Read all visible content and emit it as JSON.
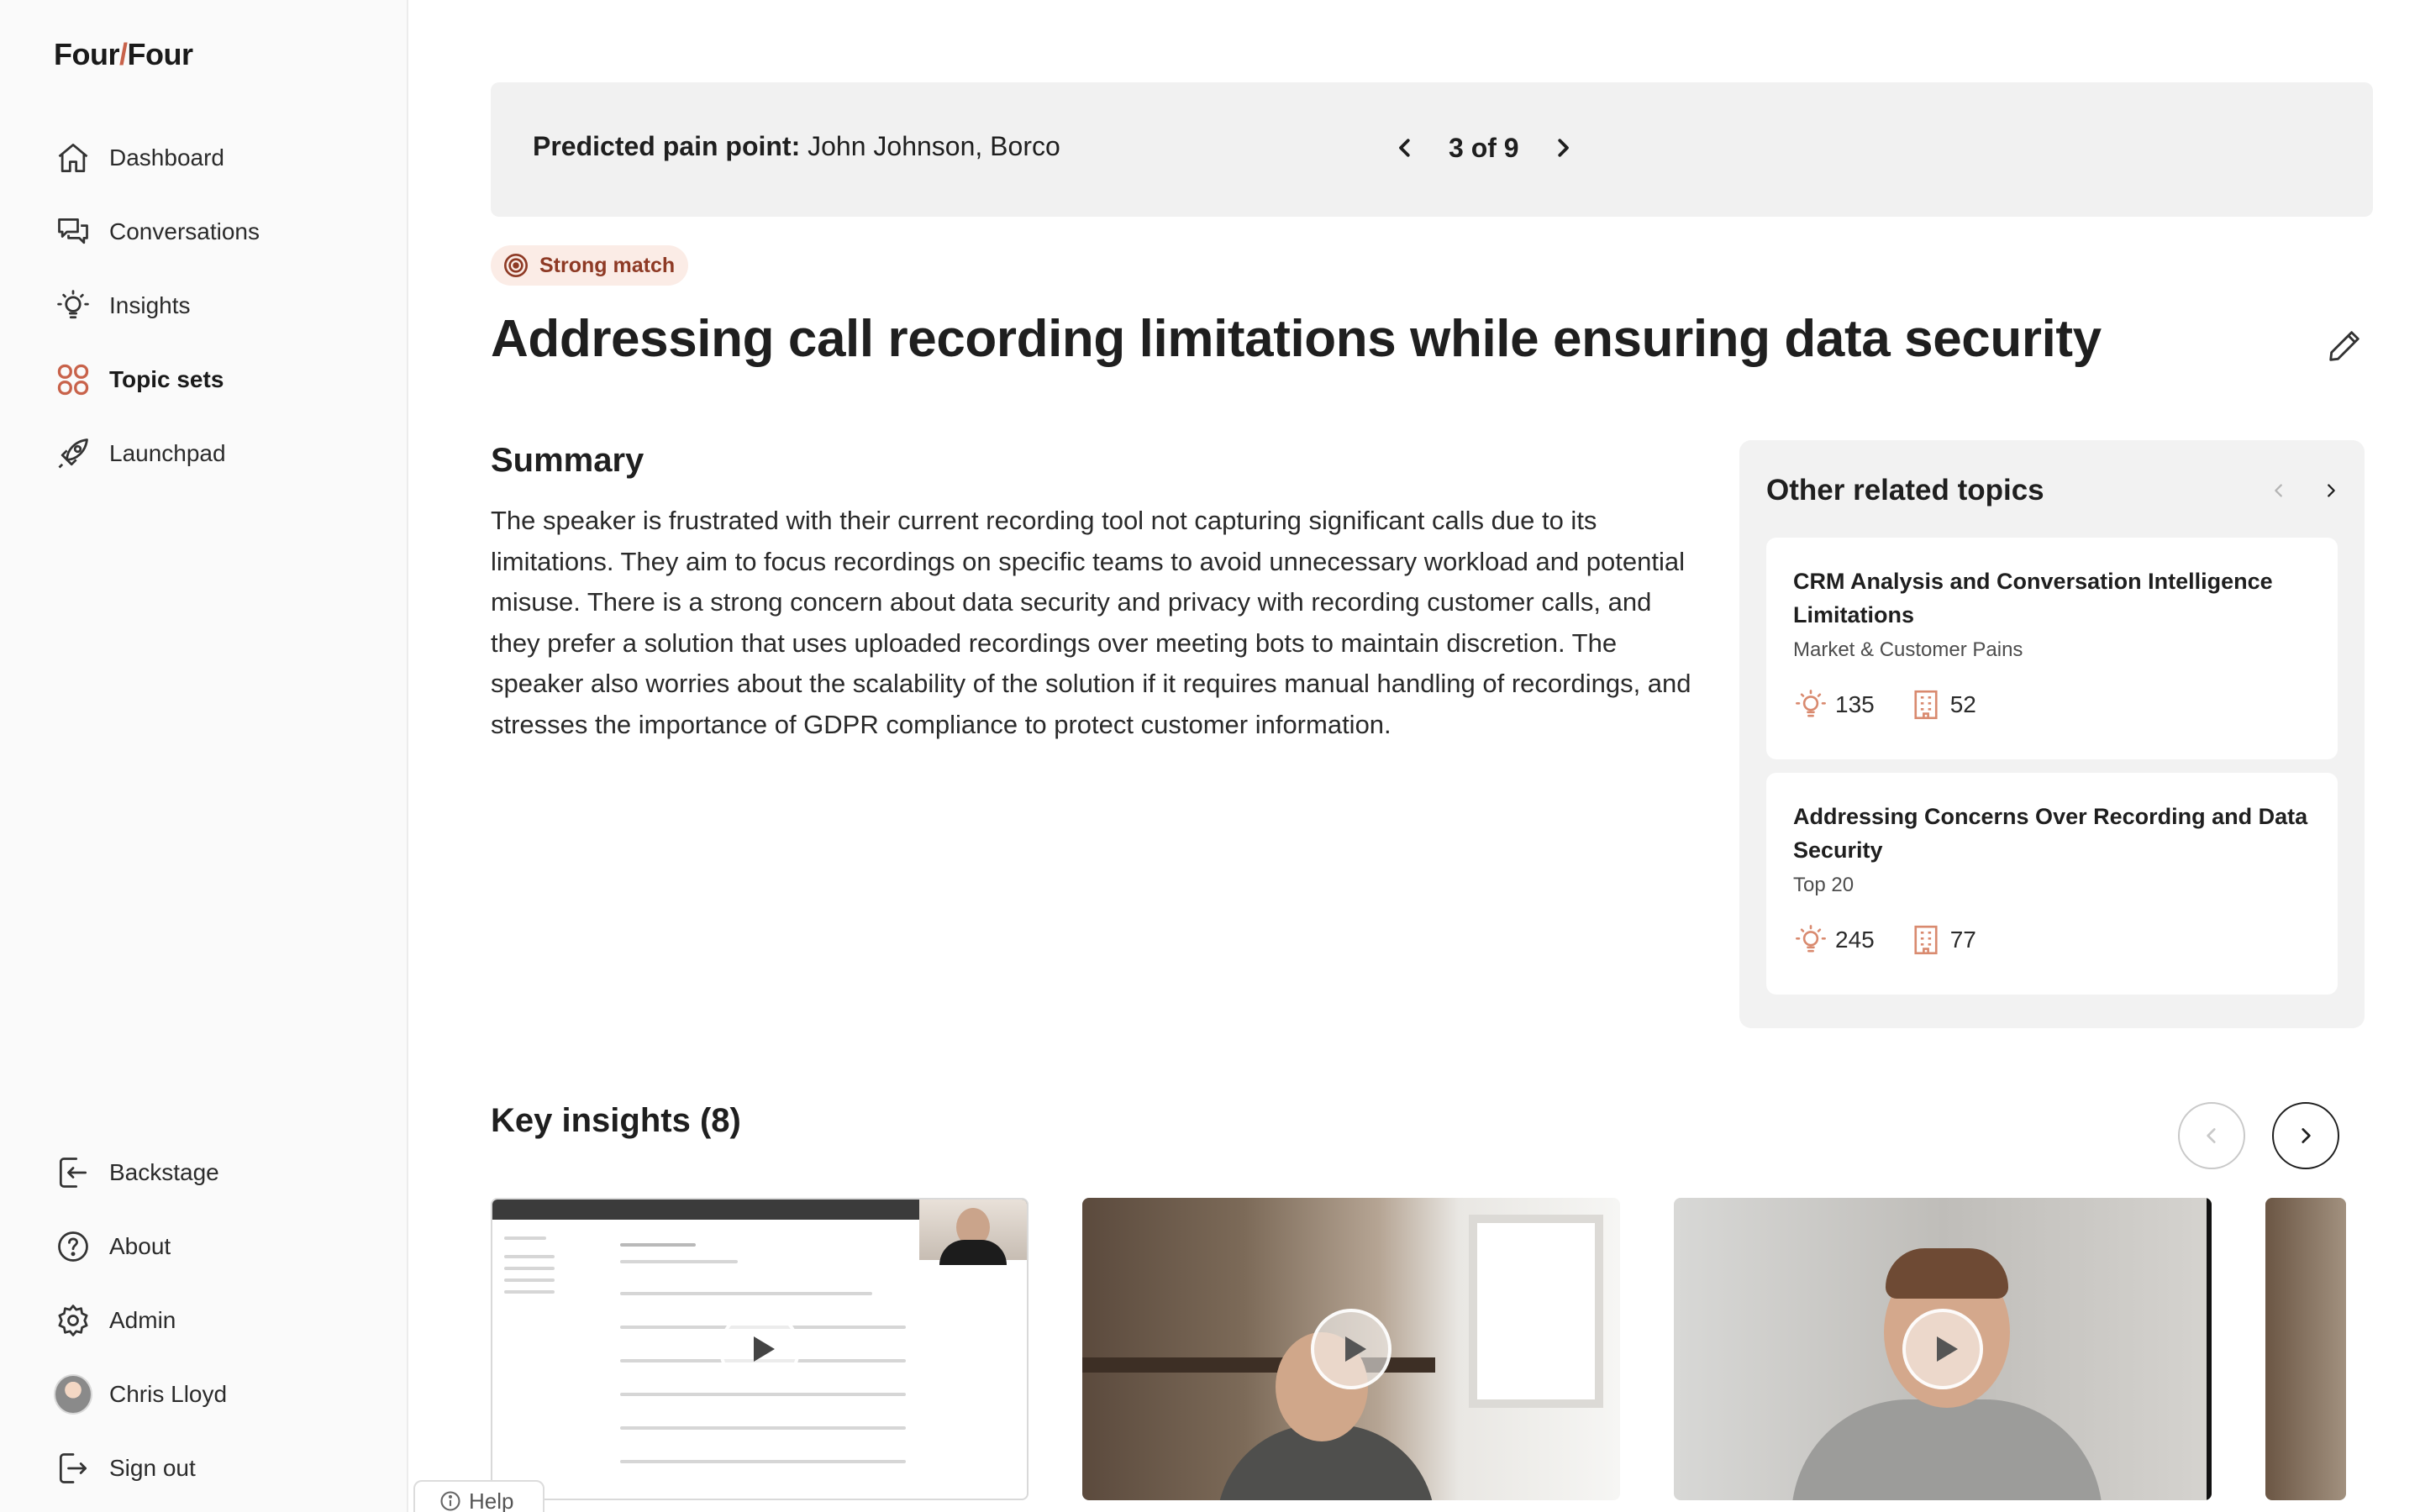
{
  "app": {
    "logo_left": "Four",
    "logo_slash": "/",
    "logo_right": "Four",
    "accent_color": "#c8624a"
  },
  "sidebar": {
    "items": [
      {
        "label": "Dashboard",
        "icon": "home-icon"
      },
      {
        "label": "Conversations",
        "icon": "chat-icon"
      },
      {
        "label": "Insights",
        "icon": "lightbulb-icon"
      },
      {
        "label": "Topic sets",
        "icon": "grid-icon",
        "active": true
      },
      {
        "label": "Launchpad",
        "icon": "rocket-icon"
      }
    ],
    "bottom_items": [
      {
        "label": "Backstage",
        "icon": "enter-icon"
      },
      {
        "label": "About",
        "icon": "question-icon"
      },
      {
        "label": "Admin",
        "icon": "gear-icon"
      },
      {
        "label": "Chris Lloyd",
        "icon": "avatar"
      },
      {
        "label": "Sign out",
        "icon": "sign-out-icon"
      }
    ]
  },
  "banner": {
    "label": "Predicted pain point:",
    "value": "John Johnson, Borco",
    "pager": "3 of 9"
  },
  "topic": {
    "badge": "Strong match",
    "title": "Addressing call recording limitations while ensuring data security",
    "summary_heading": "Summary",
    "summary": "The speaker is frustrated with their current recording tool not capturing significant calls due to its limitations. They aim to focus recordings on specific teams to avoid unnecessary workload and potential misuse. There is a strong concern about data security and privacy with recording customer calls, and they prefer a solution that uses uploaded recordings over meeting bots to maintain discretion. The speaker also worries about the scalability of the solution if it requires manual handling of recordings, and stresses the importance of GDPR compliance to protect customer information."
  },
  "related": {
    "heading": "Other related topics",
    "cards": [
      {
        "title": "CRM Analysis and Conversation Intelligence Limitations",
        "subtitle": "Market & Customer Pains",
        "insights": "135",
        "companies": "52"
      },
      {
        "title": "Addressing Concerns Over Recording and Data Security",
        "subtitle": "Top 20",
        "insights": "245",
        "companies": "77"
      }
    ]
  },
  "key_insights": {
    "heading": "Key insights (8)"
  },
  "help": {
    "label": "Help"
  }
}
